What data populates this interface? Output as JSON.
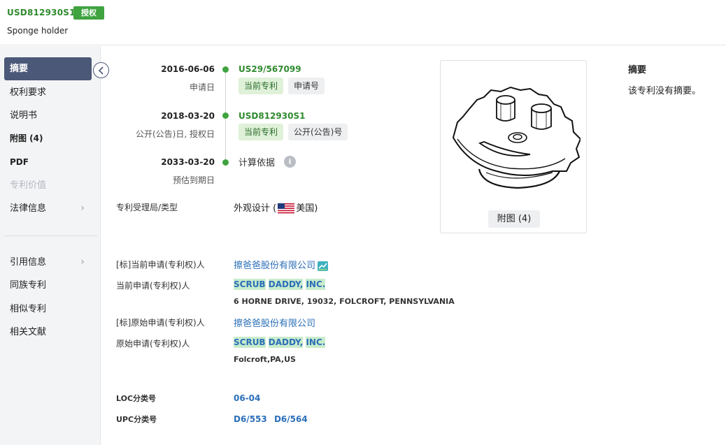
{
  "header": {
    "patent_number": "USD812930S1",
    "status_badge": "授权",
    "title": "Sponge holder"
  },
  "sidebar": {
    "items": [
      {
        "label": "摘要",
        "active": true
      },
      {
        "label": "权利要求"
      },
      {
        "label": "说明书"
      },
      {
        "label": "附图 (4)"
      },
      {
        "label": "PDF"
      },
      {
        "label": "专利价值",
        "disabled": true
      },
      {
        "label": "法律信息",
        "has_chevron": true
      },
      {
        "label": "引用信息",
        "has_chevron": true
      },
      {
        "label": "同族专利"
      },
      {
        "label": "相似专利"
      },
      {
        "label": "相关文献"
      }
    ]
  },
  "timeline": {
    "application": {
      "date": "2016-06-06",
      "label": "申请日",
      "number": "US29/567099",
      "tag_current": "当前专利",
      "tag_type": "申请号"
    },
    "publication": {
      "date": "2018-03-20",
      "label": "公开(公告)日, 授权日",
      "number": "USD812930S1",
      "tag_current": "当前专利",
      "tag_type": "公开(公告)号"
    },
    "expiry": {
      "date": "2033-03-20",
      "label": "预估到期日",
      "calc_basis": "计算依据",
      "info_icon": "i"
    }
  },
  "fields": {
    "office_type": {
      "label": "专利受理局/类型",
      "value_prefix": "外观设计 (",
      "country": "美国",
      "value_suffix": ")"
    },
    "current_applicant_std": {
      "label": "[标]当前申请(专利权)人",
      "value": "擦爸爸股份有限公司"
    },
    "current_applicant": {
      "label": "当前申请(专利权)人",
      "name_parts": [
        "SCRUB",
        "DADDY,",
        "INC."
      ],
      "address": "6 HORNE DRIVE, 19032, FOLCROFT, PENNSYLVANIA"
    },
    "original_applicant_std": {
      "label": "[标]原始申请(专利权)人",
      "value": "擦爸爸股份有限公司"
    },
    "original_applicant": {
      "label": "原始申请(专利权)人",
      "name_parts": [
        "SCRUB",
        "DADDY,",
        "INC."
      ],
      "address": "Folcroft,PA,US"
    },
    "loc": {
      "label": "LOC分类号",
      "value": "06-04"
    },
    "upc": {
      "label": "UPC分类号",
      "values": [
        "D6/553",
        "D6/564"
      ]
    }
  },
  "figure": {
    "button_label": "附图 (4)"
  },
  "abstract": {
    "title": "摘要",
    "text": "该专利没有摘要。"
  },
  "colors": {
    "accent_green": "#3fa33f",
    "sidebar_active": "#4b5877",
    "link_blue": "#2b6fb8",
    "highlight": "#c8eccc"
  }
}
